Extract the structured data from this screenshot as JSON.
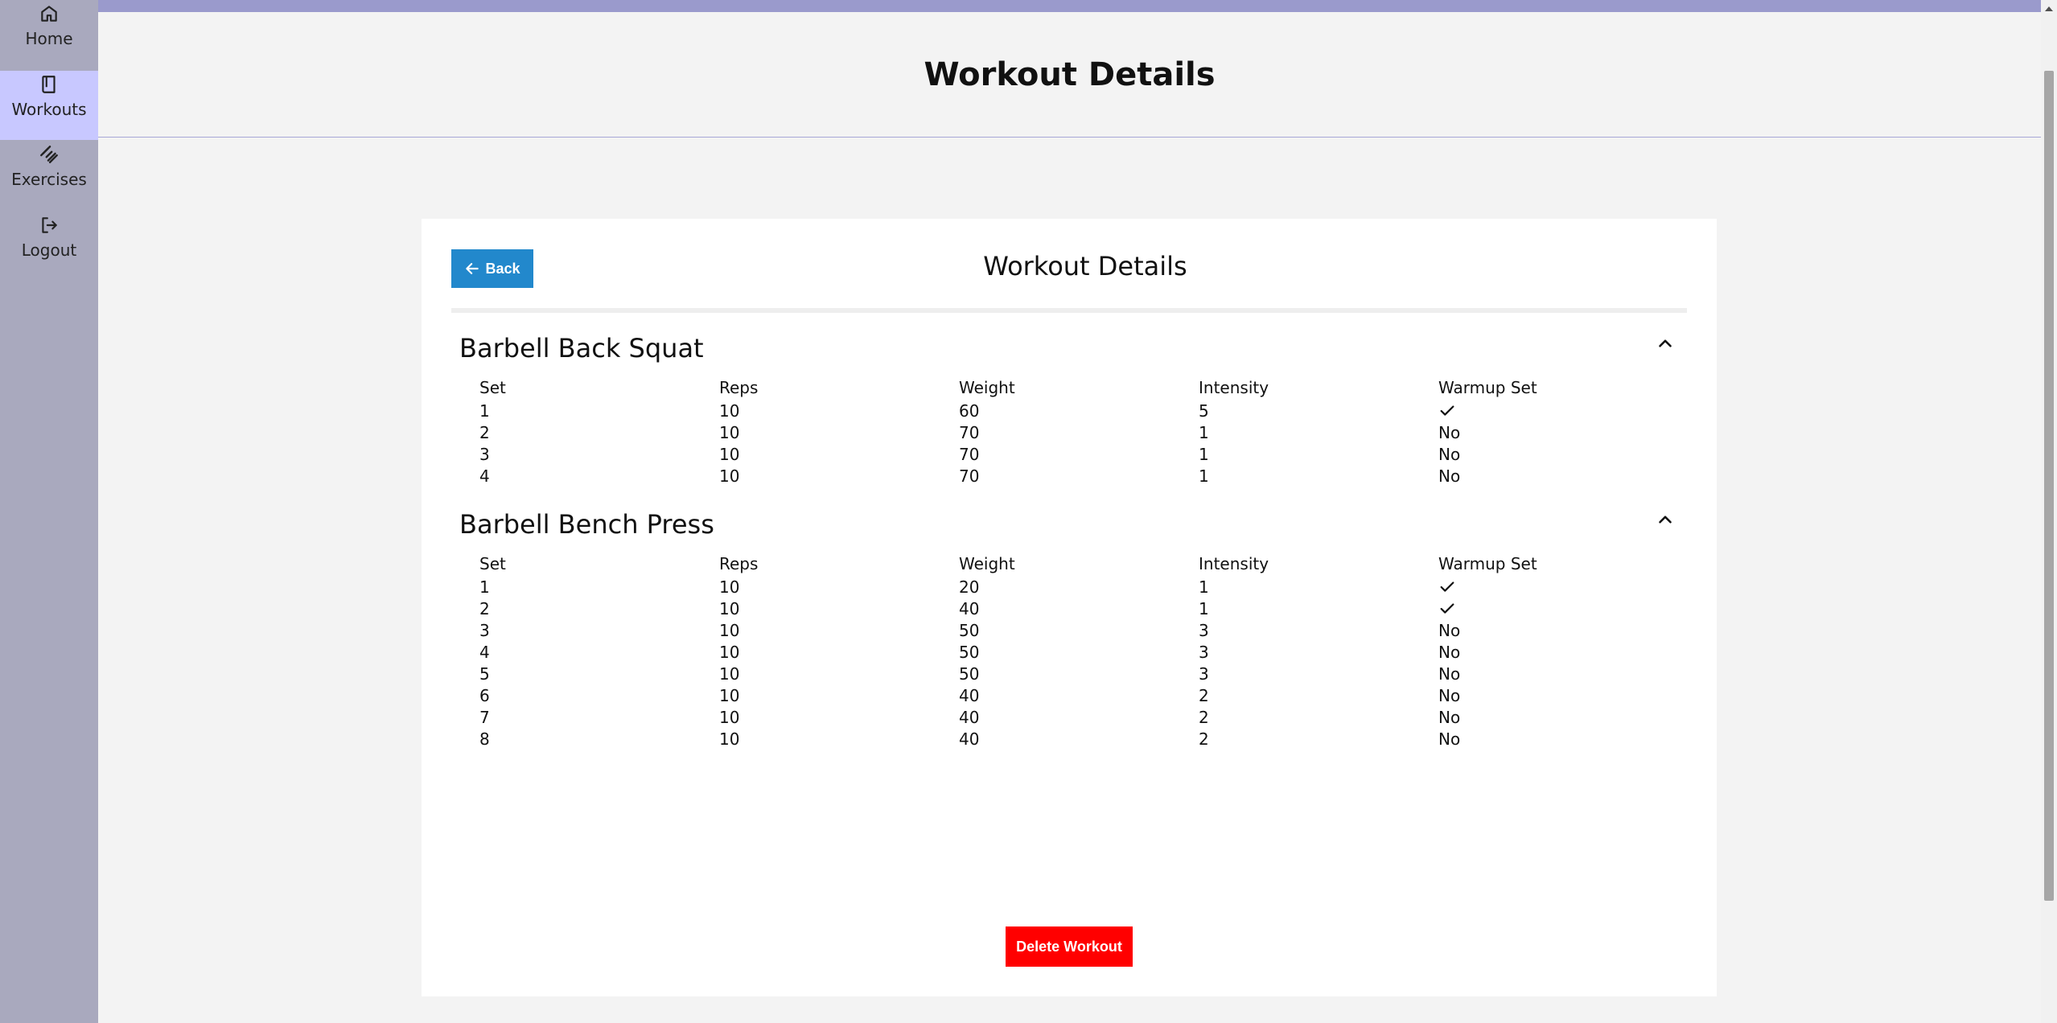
{
  "sidebar": {
    "items": [
      {
        "label": "Home",
        "icon": "home-icon",
        "active": false
      },
      {
        "label": "Workouts",
        "icon": "book-icon",
        "active": true
      },
      {
        "label": "Exercises",
        "icon": "dumbbell-icon",
        "active": false
      },
      {
        "label": "Logout",
        "icon": "logout-icon",
        "active": false
      }
    ]
  },
  "header": {
    "title": "Workout Details"
  },
  "card": {
    "title": "Workout Details",
    "back_label": "Back",
    "delete_label": "Delete Workout"
  },
  "table_headers": [
    "Set",
    "Reps",
    "Weight",
    "Intensity",
    "Warmup Set"
  ],
  "exercises": [
    {
      "name": "Barbell Back Squat",
      "sets": [
        {
          "set": "1",
          "reps": "10",
          "weight": "60",
          "intensity": "5",
          "warmup": true
        },
        {
          "set": "2",
          "reps": "10",
          "weight": "70",
          "intensity": "1",
          "warmup": "No"
        },
        {
          "set": "3",
          "reps": "10",
          "weight": "70",
          "intensity": "1",
          "warmup": "No"
        },
        {
          "set": "4",
          "reps": "10",
          "weight": "70",
          "intensity": "1",
          "warmup": "No"
        }
      ]
    },
    {
      "name": "Barbell Bench Press",
      "sets": [
        {
          "set": "1",
          "reps": "10",
          "weight": "20",
          "intensity": "1",
          "warmup": true
        },
        {
          "set": "2",
          "reps": "10",
          "weight": "40",
          "intensity": "1",
          "warmup": true
        },
        {
          "set": "3",
          "reps": "10",
          "weight": "50",
          "intensity": "3",
          "warmup": "No"
        },
        {
          "set": "4",
          "reps": "10",
          "weight": "50",
          "intensity": "3",
          "warmup": "No"
        },
        {
          "set": "5",
          "reps": "10",
          "weight": "50",
          "intensity": "3",
          "warmup": "No"
        },
        {
          "set": "6",
          "reps": "10",
          "weight": "40",
          "intensity": "2",
          "warmup": "No"
        },
        {
          "set": "7",
          "reps": "10",
          "weight": "40",
          "intensity": "2",
          "warmup": "No"
        },
        {
          "set": "8",
          "reps": "10",
          "weight": "40",
          "intensity": "2",
          "warmup": "No"
        }
      ]
    }
  ],
  "colors": {
    "sidebar_bg": "#a9a9be",
    "active_nav": "#c8c8ff",
    "accent_bar": "#9a9acc",
    "back_button": "#2288cc",
    "delete_button": "#ff0000"
  }
}
